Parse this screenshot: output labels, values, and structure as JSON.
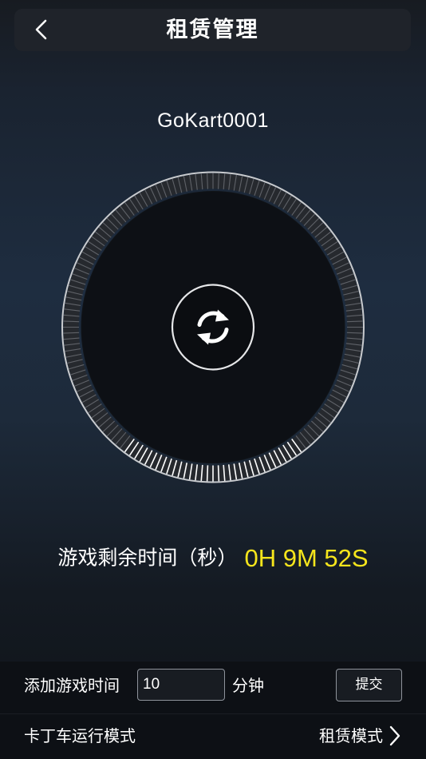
{
  "header": {
    "title": "租赁管理",
    "back_icon": "chevron-left-icon"
  },
  "device": {
    "name": "GoKart0001"
  },
  "dial": {
    "refresh_icon": "refresh-icon",
    "progress_fraction": 0.2,
    "progress_color": "#ffffff",
    "track_color": "#5f6268"
  },
  "timer": {
    "label": "游戏剩余时间（秒）",
    "value": "0H 9M 52S",
    "value_color": "#f6e51c"
  },
  "add_time": {
    "label": "添加游戏时间",
    "input_value": "10",
    "unit": "分钟",
    "submit_label": "提交"
  },
  "mode": {
    "label": "卡丁车运行模式",
    "value": "租赁模式",
    "chevron_icon": "chevron-right-icon"
  }
}
